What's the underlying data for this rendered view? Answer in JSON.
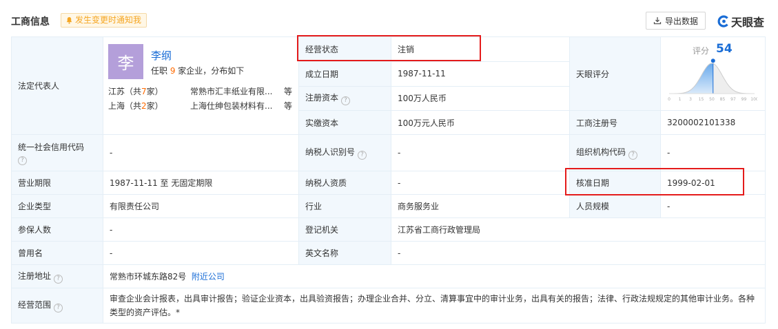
{
  "header": {
    "title": "工商信息",
    "notify_label": "发生变更时通知我",
    "export_label": "导出数据",
    "brand": "天眼查"
  },
  "legal_rep": {
    "label": "法定代表人",
    "avatar_char": "李",
    "name": "李纲",
    "positions_prefix": "任职 ",
    "positions_count": "9",
    "positions_suffix": " 家企业，分布如下",
    "regions": [
      {
        "prefix": "江苏（共",
        "count": "7",
        "suffix": "家）",
        "company": "常熟市汇丰纸业有限...",
        "etc": "等"
      },
      {
        "prefix": "上海（共",
        "count": "2",
        "suffix": "家）",
        "company": "上海仕绅包装材料有...",
        "etc": "等"
      }
    ]
  },
  "fields": {
    "status_label": "经营状态",
    "status_value": "注销",
    "established_label": "成立日期",
    "established_value": "1987-11-11",
    "reg_capital_label": "注册资本",
    "reg_capital_value": "100万人民币",
    "paid_capital_label": "实缴资本",
    "paid_capital_value": "100万元人民币",
    "tianyan_score_label": "天眼评分",
    "reg_no_label": "工商注册号",
    "reg_no_value": "3200002101338",
    "credit_code_label": "统一社会信用代码",
    "credit_code_value": "-",
    "taxpayer_id_label": "纳税人识别号",
    "taxpayer_id_value": "-",
    "org_code_label": "组织机构代码",
    "org_code_value": "-",
    "term_label": "营业期限",
    "term_value": "1987-11-11 至 无固定期限",
    "taxpayer_qual_label": "纳税人资质",
    "taxpayer_qual_value": "-",
    "approval_date_label": "核准日期",
    "approval_date_value": "1999-02-01",
    "company_type_label": "企业类型",
    "company_type_value": "有限责任公司",
    "industry_label": "行业",
    "industry_value": "商务服务业",
    "staff_size_label": "人员规模",
    "staff_size_value": "-",
    "insured_label": "参保人数",
    "insured_value": "-",
    "reg_authority_label": "登记机关",
    "reg_authority_value": "江苏省工商行政管理局",
    "former_name_label": "曾用名",
    "former_name_value": "-",
    "english_name_label": "英文名称",
    "english_name_value": "-",
    "address_label": "注册地址",
    "address_value": "常熟市环城东路82号",
    "nearby_link": "附近公司",
    "scope_label": "经营范围",
    "scope_value": "审查企业会计报表，出具审计报告；验证企业资本，出具验资报告；办理企业合并、分立、清算事宜中的审计业务，出具有关的报告；法律、行政法规规定的其他审计业务。各种类型的资产评估。*"
  },
  "score": {
    "label": "评分",
    "value": 54,
    "ticks": [
      "0",
      "1",
      "3",
      "15",
      "50",
      "85",
      "97",
      "99",
      "100"
    ],
    "curve_color": "#4a90e2",
    "marker_color": "#1a6dd6"
  }
}
